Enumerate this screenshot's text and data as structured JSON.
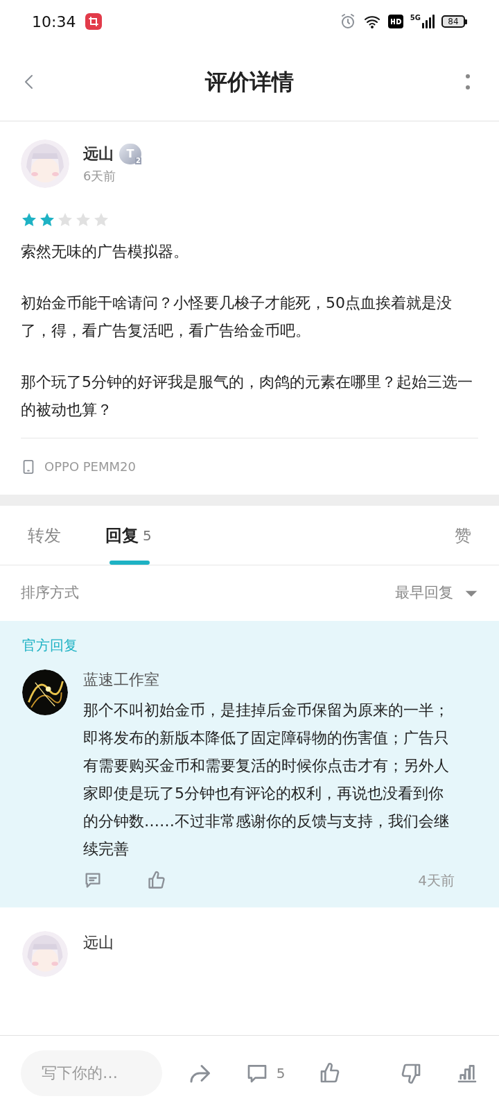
{
  "status_bar": {
    "time": "10:34",
    "battery": "84",
    "network": "5G"
  },
  "header": {
    "title": "评价详情"
  },
  "review": {
    "author": "远山",
    "badge": "T",
    "badge_sub": "2",
    "time": "6天前",
    "stars": 2,
    "paragraphs": [
      "索然无味的广告模拟器。",
      "初始金币能干啥请问？小怪要几梭子才能死，50点血挨着就是没了，得，看广告复活吧，看广告给金币吧。",
      "那个玩了5分钟的好评我是服气的，肉鸽的元素在哪里？起始三选一的被动也算？"
    ],
    "device": "OPPO PEMM20"
  },
  "tabs": [
    {
      "label": "转发",
      "selected": false
    },
    {
      "label": "回复",
      "count": "5",
      "selected": true
    },
    {
      "label": "赞",
      "selected": false
    }
  ],
  "sort": {
    "label": "排序方式",
    "value": "最早回复"
  },
  "replies": [
    {
      "kind": "official",
      "tag": "官方回复",
      "author": "蓝速工作室",
      "text": "那个不叫初始金币，是挂掉后金币保留为原来的一半；即将发布的新版本降低了固定障碍物的伤害值；广告只有需要购买金币和需要复活的时候你点击才有；另外人家即使是玩了5分钟也有评论的权利，再说也没看到你的分钟数……不过非常感谢你的反馈与支持，我们会继续完善",
      "time": "4天前"
    },
    {
      "kind": "user",
      "author": "远山"
    }
  ],
  "bottom_bar": {
    "placeholder": "写下你的…",
    "comment_count": "5"
  }
}
